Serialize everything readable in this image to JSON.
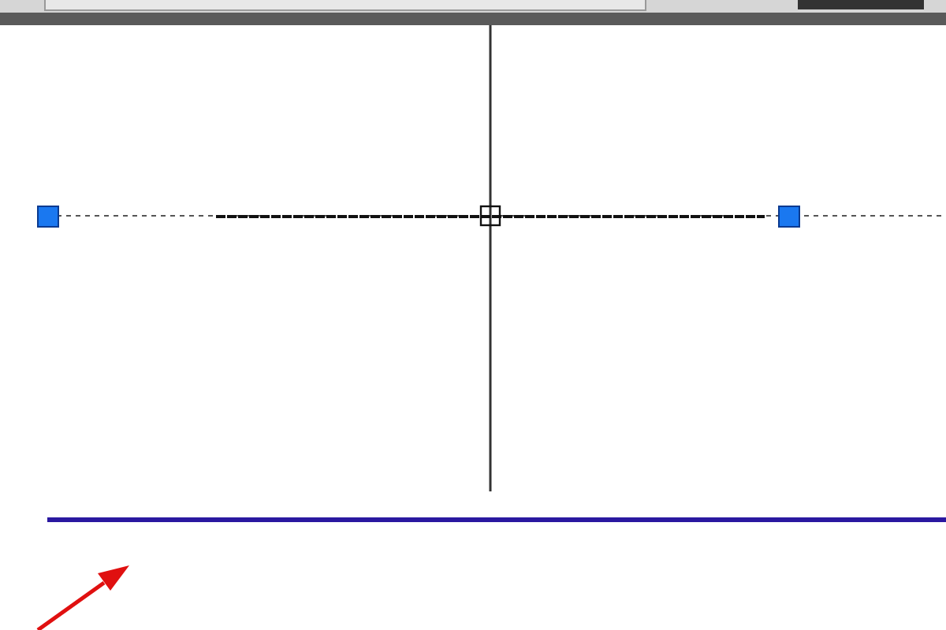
{
  "canvas": {
    "grips": [
      {
        "selected": false
      },
      {
        "selected": false
      }
    ]
  }
}
